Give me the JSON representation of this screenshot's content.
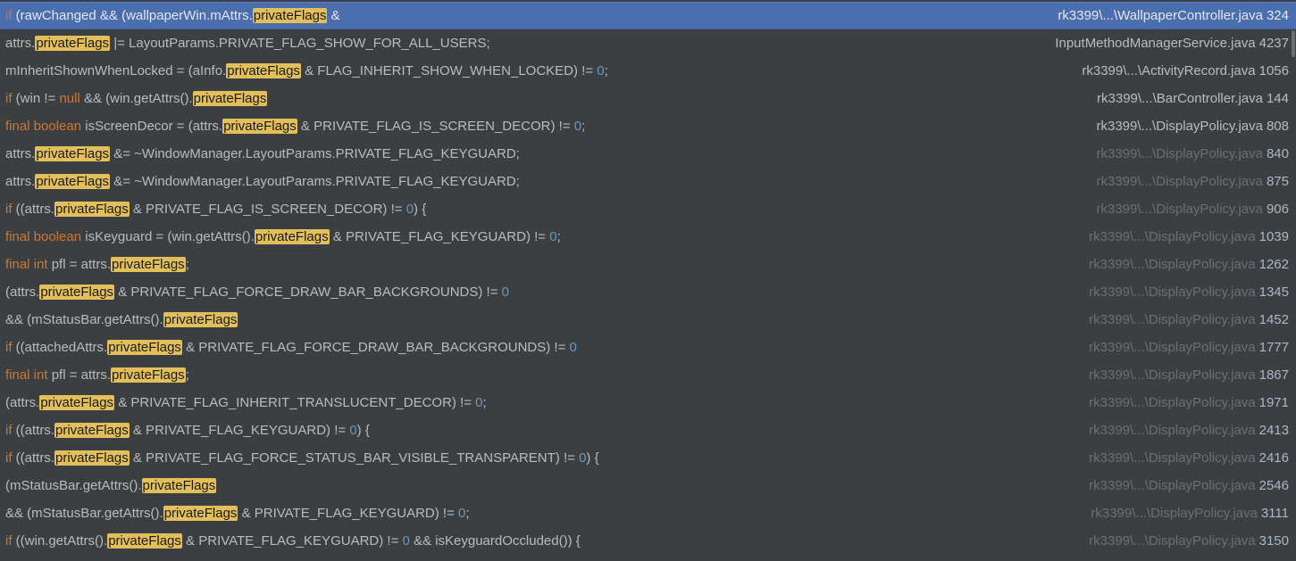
{
  "results": [
    {
      "selected": true,
      "path": "rk3399\\...\\WallpaperController.java",
      "line": "324",
      "dim": false,
      "segments": [
        {
          "t": "if ",
          "c": "kw"
        },
        {
          "t": "(rawChanged && (wallpaperWin.mAttrs."
        },
        {
          "t": "privateFlags",
          "c": "hl"
        },
        {
          "t": " &"
        }
      ]
    },
    {
      "selected": false,
      "path": "InputMethodManagerService.java",
      "line": "4237",
      "dim": false,
      "segments": [
        {
          "t": "attrs."
        },
        {
          "t": "privateFlags",
          "c": "hl"
        },
        {
          "t": " |= LayoutParams.PRIVATE_FLAG_SHOW_FOR_ALL_USERS;"
        }
      ]
    },
    {
      "selected": false,
      "path": "rk3399\\...\\ActivityRecord.java",
      "line": "1056",
      "dim": false,
      "segments": [
        {
          "t": "mInheritShownWhenLocked = (aInfo."
        },
        {
          "t": "privateFlags",
          "c": "hl"
        },
        {
          "t": " & FLAG_INHERIT_SHOW_WHEN_LOCKED) != "
        },
        {
          "t": "0",
          "c": "num"
        },
        {
          "t": ";"
        }
      ]
    },
    {
      "selected": false,
      "path": "rk3399\\...\\BarController.java",
      "line": "144",
      "dim": false,
      "segments": [
        {
          "t": "if ",
          "c": "kw"
        },
        {
          "t": "(win != "
        },
        {
          "t": "null",
          "c": "kw"
        },
        {
          "t": " && (win.getAttrs()."
        },
        {
          "t": "privateFlags",
          "c": "hl"
        }
      ]
    },
    {
      "selected": false,
      "path": "rk3399\\...\\DisplayPolicy.java",
      "line": "808",
      "dim": false,
      "segments": [
        {
          "t": "final boolean ",
          "c": "kw"
        },
        {
          "t": "isScreenDecor = (attrs."
        },
        {
          "t": "privateFlags",
          "c": "hl"
        },
        {
          "t": " & PRIVATE_FLAG_IS_SCREEN_DECOR) != "
        },
        {
          "t": "0",
          "c": "num"
        },
        {
          "t": ";"
        }
      ]
    },
    {
      "selected": false,
      "path": "rk3399\\...\\DisplayPolicy.java",
      "line": "840",
      "dim": true,
      "segments": [
        {
          "t": "attrs."
        },
        {
          "t": "privateFlags",
          "c": "hl"
        },
        {
          "t": " &= ~WindowManager.LayoutParams.PRIVATE_FLAG_KEYGUARD;"
        }
      ]
    },
    {
      "selected": false,
      "path": "rk3399\\...\\DisplayPolicy.java",
      "line": "875",
      "dim": true,
      "segments": [
        {
          "t": "attrs."
        },
        {
          "t": "privateFlags",
          "c": "hl"
        },
        {
          "t": " &= ~WindowManager.LayoutParams.PRIVATE_FLAG_KEYGUARD;"
        }
      ]
    },
    {
      "selected": false,
      "path": "rk3399\\...\\DisplayPolicy.java",
      "line": "906",
      "dim": true,
      "segments": [
        {
          "t": "if ",
          "c": "kw"
        },
        {
          "t": "((attrs."
        },
        {
          "t": "privateFlags",
          "c": "hl"
        },
        {
          "t": " & PRIVATE_FLAG_IS_SCREEN_DECOR) != "
        },
        {
          "t": "0",
          "c": "num"
        },
        {
          "t": ") {"
        }
      ]
    },
    {
      "selected": false,
      "path": "rk3399\\...\\DisplayPolicy.java",
      "line": "1039",
      "dim": true,
      "segments": [
        {
          "t": "final boolean ",
          "c": "kw"
        },
        {
          "t": "isKeyguard = (win.getAttrs()."
        },
        {
          "t": "privateFlags",
          "c": "hl"
        },
        {
          "t": " & PRIVATE_FLAG_KEYGUARD) != "
        },
        {
          "t": "0",
          "c": "num"
        },
        {
          "t": ";"
        }
      ]
    },
    {
      "selected": false,
      "path": "rk3399\\...\\DisplayPolicy.java",
      "line": "1262",
      "dim": true,
      "segments": [
        {
          "t": "final int ",
          "c": "kw"
        },
        {
          "t": "pfl = attrs."
        },
        {
          "t": "privateFlags",
          "c": "hl"
        },
        {
          "t": ";"
        }
      ]
    },
    {
      "selected": false,
      "path": "rk3399\\...\\DisplayPolicy.java",
      "line": "1345",
      "dim": true,
      "segments": [
        {
          "t": "(attrs."
        },
        {
          "t": "privateFlags",
          "c": "hl"
        },
        {
          "t": " & PRIVATE_FLAG_FORCE_DRAW_BAR_BACKGROUNDS) != "
        },
        {
          "t": "0",
          "c": "num"
        }
      ]
    },
    {
      "selected": false,
      "path": "rk3399\\...\\DisplayPolicy.java",
      "line": "1452",
      "dim": true,
      "segments": [
        {
          "t": "&& (mStatusBar.getAttrs()."
        },
        {
          "t": "privateFlags",
          "c": "hl"
        }
      ]
    },
    {
      "selected": false,
      "path": "rk3399\\...\\DisplayPolicy.java",
      "line": "1777",
      "dim": true,
      "segments": [
        {
          "t": "if ",
          "c": "kw"
        },
        {
          "t": "((attachedAttrs."
        },
        {
          "t": "privateFlags",
          "c": "hl"
        },
        {
          "t": " & PRIVATE_FLAG_FORCE_DRAW_BAR_BACKGROUNDS) != "
        },
        {
          "t": "0",
          "c": "num"
        }
      ]
    },
    {
      "selected": false,
      "path": "rk3399\\...\\DisplayPolicy.java",
      "line": "1867",
      "dim": true,
      "segments": [
        {
          "t": "final int ",
          "c": "kw"
        },
        {
          "t": "pfl = attrs."
        },
        {
          "t": "privateFlags",
          "c": "hl"
        },
        {
          "t": ";"
        }
      ]
    },
    {
      "selected": false,
      "path": "rk3399\\...\\DisplayPolicy.java",
      "line": "1971",
      "dim": true,
      "segments": [
        {
          "t": "(attrs."
        },
        {
          "t": "privateFlags",
          "c": "hl"
        },
        {
          "t": " & PRIVATE_FLAG_INHERIT_TRANSLUCENT_DECOR) != "
        },
        {
          "t": "0",
          "c": "num"
        },
        {
          "t": ";"
        }
      ]
    },
    {
      "selected": false,
      "path": "rk3399\\...\\DisplayPolicy.java",
      "line": "2413",
      "dim": true,
      "segments": [
        {
          "t": "if ",
          "c": "kw"
        },
        {
          "t": "((attrs."
        },
        {
          "t": "privateFlags",
          "c": "hl"
        },
        {
          "t": " & PRIVATE_FLAG_KEYGUARD) != "
        },
        {
          "t": "0",
          "c": "num"
        },
        {
          "t": ") {"
        }
      ]
    },
    {
      "selected": false,
      "path": "rk3399\\...\\DisplayPolicy.java",
      "line": "2416",
      "dim": true,
      "segments": [
        {
          "t": "if ",
          "c": "kw"
        },
        {
          "t": "((attrs."
        },
        {
          "t": "privateFlags",
          "c": "hl"
        },
        {
          "t": " & PRIVATE_FLAG_FORCE_STATUS_BAR_VISIBLE_TRANSPARENT) != "
        },
        {
          "t": "0",
          "c": "num"
        },
        {
          "t": ") {"
        }
      ]
    },
    {
      "selected": false,
      "path": "rk3399\\...\\DisplayPolicy.java",
      "line": "2546",
      "dim": true,
      "segments": [
        {
          "t": "(mStatusBar.getAttrs()."
        },
        {
          "t": "privateFlags",
          "c": "hl"
        }
      ]
    },
    {
      "selected": false,
      "path": "rk3399\\...\\DisplayPolicy.java",
      "line": "3111",
      "dim": true,
      "segments": [
        {
          "t": "&& (mStatusBar.getAttrs()."
        },
        {
          "t": "privateFlags",
          "c": "hl"
        },
        {
          "t": " & PRIVATE_FLAG_KEYGUARD) != "
        },
        {
          "t": "0",
          "c": "num"
        },
        {
          "t": ";"
        }
      ]
    },
    {
      "selected": false,
      "path": "rk3399\\...\\DisplayPolicy.java",
      "line": "3150",
      "dim": true,
      "segments": [
        {
          "t": "if ",
          "c": "kw"
        },
        {
          "t": "((win.getAttrs()."
        },
        {
          "t": "privateFlags",
          "c": "hl"
        },
        {
          "t": " & PRIVATE_FLAG_KEYGUARD) != "
        },
        {
          "t": "0",
          "c": "num"
        },
        {
          "t": " && isKeyguardOccluded()) {"
        }
      ]
    }
  ]
}
